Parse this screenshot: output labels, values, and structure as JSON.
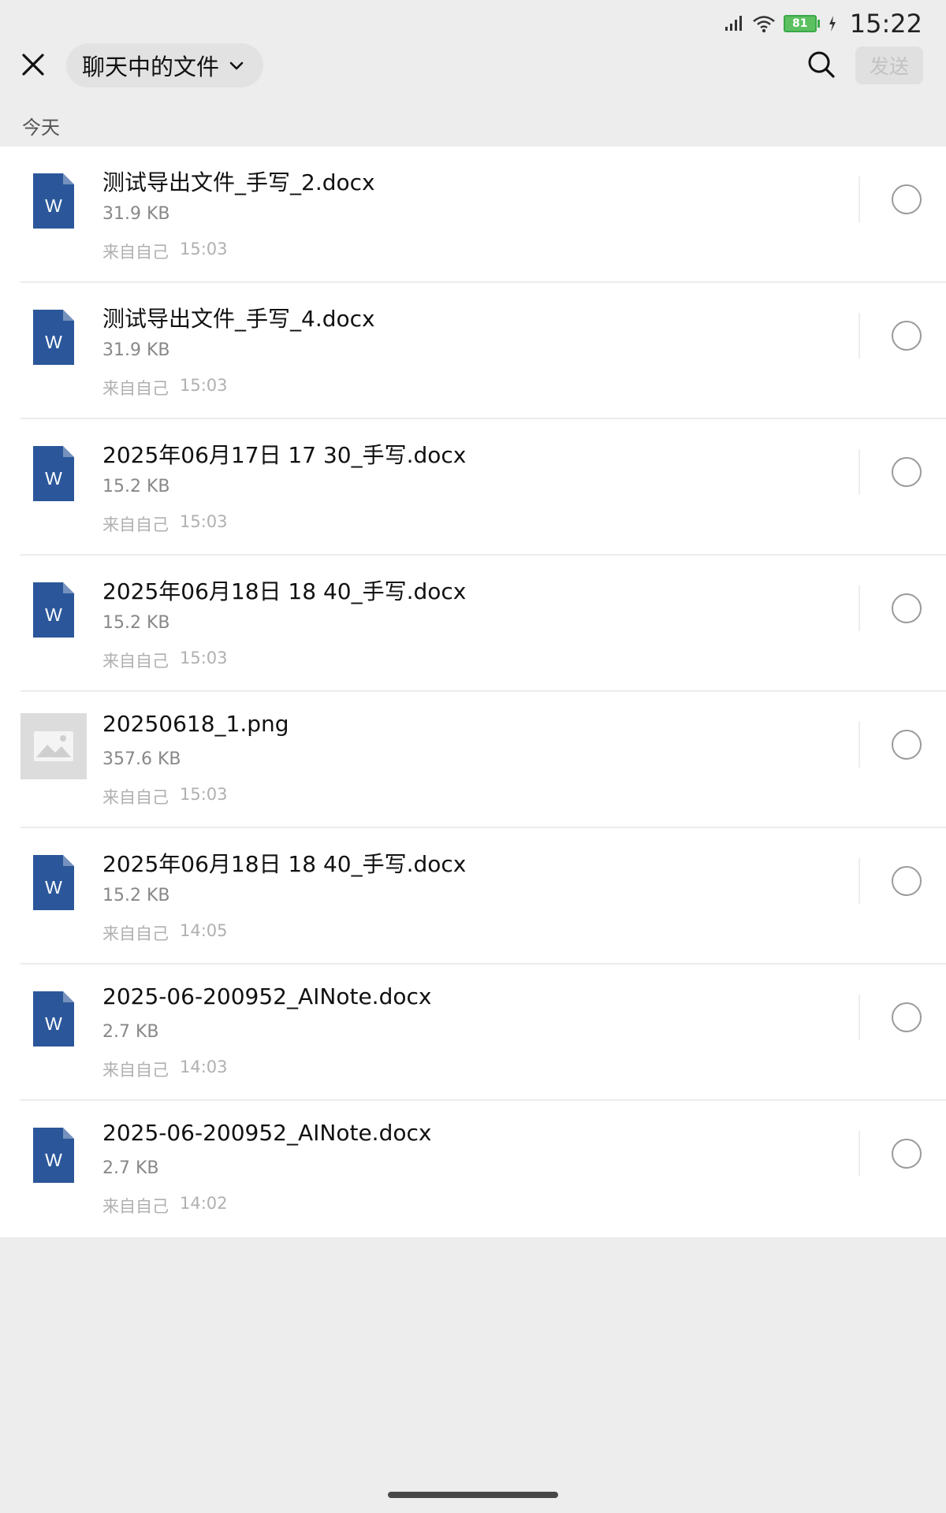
{
  "status_bar": {
    "time": "15:22",
    "battery_level": "81",
    "icons": [
      "signal-icon",
      "wifi-icon",
      "battery-icon",
      "charging-icon"
    ]
  },
  "header": {
    "close_icon": "close-icon",
    "title": "聊天中的文件",
    "dropdown_icon": "chevron-down-icon",
    "search_icon": "search-icon",
    "send_label": "发送"
  },
  "section": {
    "label": "今天"
  },
  "files": [
    {
      "name": "测试导出文件_手写_2.docx",
      "size": "31.9 KB",
      "source": "来自自己",
      "time": "15:03",
      "type": "word"
    },
    {
      "name": "测试导出文件_手写_4.docx",
      "size": "31.9 KB",
      "source": "来自自己",
      "time": "15:03",
      "type": "word"
    },
    {
      "name": "2025年06月17日 17 30_手写.docx",
      "size": "15.2 KB",
      "source": "来自自己",
      "time": "15:03",
      "type": "word"
    },
    {
      "name": "2025年06月18日 18 40_手写.docx",
      "size": "15.2 KB",
      "source": "来自自己",
      "time": "15:03",
      "type": "word"
    },
    {
      "name": "20250618_1.png",
      "size": "357.6 KB",
      "source": "来自自己",
      "time": "15:03",
      "type": "image"
    },
    {
      "name": "2025年06月18日 18 40_手写.docx",
      "size": "15.2 KB",
      "source": "来自自己",
      "time": "14:05",
      "type": "word"
    },
    {
      "name": "2025-06-200952_AINote.docx",
      "size": "2.7 KB",
      "source": "来自自己",
      "time": "14:03",
      "type": "word"
    },
    {
      "name": "2025-06-200952_AINote.docx",
      "size": "2.7 KB",
      "source": "来自自己",
      "time": "14:02",
      "type": "word"
    }
  ],
  "file_icon_letter": "W",
  "colors": {
    "word_icon": "#2b579a",
    "background": "#ededed",
    "list_background": "#ffffff",
    "battery": "#5cc060"
  }
}
